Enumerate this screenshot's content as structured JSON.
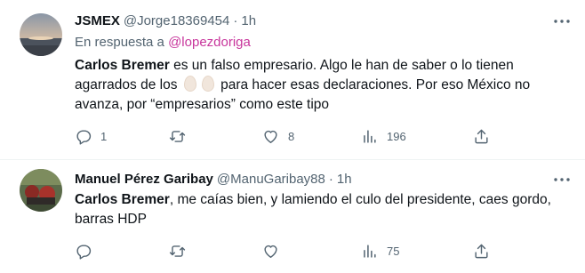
{
  "tweets": [
    {
      "name": "JSMEX",
      "handle": "@Jorge18369454",
      "time": "1h",
      "reply_prefix": "En respuesta a ",
      "reply_mention": "@lopezdoriga",
      "text_bold": "Carlos Bremer",
      "text_part1": " es un falso empresario. Algo le han de saber o lo tienen agarrados de los ",
      "text_part2": " para hacer esas declaraciones. Por eso México no avanza, por “empresarios” como este tipo",
      "reply_count": "1",
      "retweet_count": "",
      "like_count": "8",
      "view_count": "196"
    },
    {
      "name": "Manuel Pérez Garibay",
      "handle": "@ManuGaribay88",
      "time": "1h",
      "text_bold": "Carlos Bremer",
      "text_rest": ", me caías bien, y lamiendo el culo del presidente, caes gordo, barras HDP",
      "reply_count": "",
      "retweet_count": "",
      "like_count": "",
      "view_count": "75"
    }
  ],
  "icons": {
    "more": "more-dots-icon",
    "reply": "reply-icon",
    "retweet": "retweet-icon",
    "like": "heart-icon",
    "views": "views-chart-icon",
    "share": "share-icon",
    "emoji": "egg-emoji"
  },
  "colors": {
    "text": "#0f1419",
    "secondary": "#536471",
    "mention": "#c8369c",
    "divider": "#eff3f4"
  }
}
